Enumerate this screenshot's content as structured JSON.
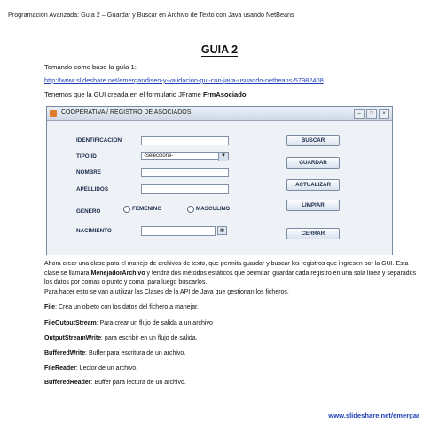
{
  "header": "Programación Avanzada: Guía 2 – Guardar y Buscar en Archivo de Texto con Java usando NetBeans",
  "title": "GUIA 2",
  "intro": "Tomando como base la guía 1:",
  "link": "http://www.slideshare.net/emergar/diseo-y-validacion-gui-con-java-usuando-netbeans-57982408",
  "gui_line": {
    "prefix": "Tenemos que la GUI creada en el formulario JFrame ",
    "bold": "FrmAsociado",
    "suffix": ":"
  },
  "window": {
    "title": "COOPERATIVA / REGISTRO DE ASOCIADOS",
    "labels": {
      "identificacion": "IDENTIFICACION",
      "tipo_id": "TIPO ID",
      "nombre": "NOMBRE",
      "apellidos": "APELLIDOS",
      "genero": "GENERO",
      "nacimiento": "NACIMIENTO"
    },
    "combo_value": "-Seleccione-",
    "radios": {
      "femenino": "FEMENINO",
      "masculino": "MASCULINO"
    },
    "buttons": {
      "buscar": "BUSCAR",
      "guardar": "GUARDAR",
      "actualizar": "ACTUALIZAR",
      "limpiar": "LIMPIAR",
      "cerrar": "CERRAR"
    }
  },
  "body": {
    "para1_a": "Ahora crear una clase para el manejo de archivos de texto, que permita guardar y buscar los registros que ingresen por la GUI. Esta clase se llamara ",
    "para1_bold": "MenejadorArchivo",
    "para1_b": " y tendrá dos métodos estáticos que permitan guardar cada registro en una sola línea y separados los datos por comas o punto y coma, para luego buscarlos.",
    "para2": "Para hacer esto se van a utilizar las Clases de la API de Java que gestionan los ficheros."
  },
  "definitions": [
    {
      "term": "File",
      "desc": ": Crea un objeto con los datos del fichero a manejar."
    },
    {
      "term": "FileOutputStream",
      "desc": ": Para crear un flujo de salida a un archivo"
    },
    {
      "term": "OutputStreamWrite",
      "desc": ": para escribir en un flujo de salida."
    },
    {
      "term": "BufferedWrite",
      "desc": ": Buffer para escritura de un archivo."
    },
    {
      "term": "FileReader",
      "desc": ": Lector de un archivo."
    },
    {
      "term": "BufferedReader",
      "desc": ": Buffer para lectura de un archivo."
    }
  ],
  "footer": "www.slideshare.net/emergar"
}
